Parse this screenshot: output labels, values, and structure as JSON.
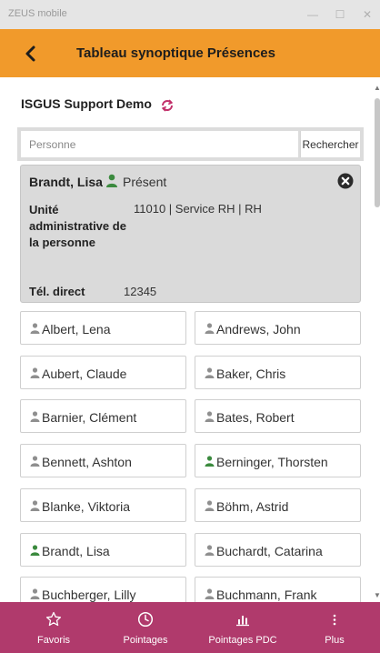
{
  "window": {
    "title": "ZEUS mobile",
    "controls": {
      "minimize": "—",
      "maximize": "☐",
      "close": "✕"
    }
  },
  "header": {
    "back_icon": "chevron-left-icon",
    "title": "Tableau synoptique Présences"
  },
  "org": {
    "name": "ISGUS Support Demo",
    "refresh_icon": "refresh-icon"
  },
  "search": {
    "placeholder": "Personne",
    "value": "",
    "button_label": "Rechercher"
  },
  "detail": {
    "name": "Brandt, Lisa",
    "status": "Présent",
    "status_color": "#3b8a3e",
    "unit_label": "Unité administrative de la personne",
    "unit_value": "11010 | Service RH |  RH",
    "tel_label": "Tél. direct",
    "tel_value": "12345"
  },
  "colors": {
    "accent_orange": "#f19a2b",
    "nav_magenta": "#b03a6c",
    "present_green": "#3b8a3e",
    "absent_gray": "#8f8f8f"
  },
  "persons": [
    {
      "name": "Albert, Lena",
      "present": false
    },
    {
      "name": "Andrews, John",
      "present": false
    },
    {
      "name": "Aubert, Claude",
      "present": false
    },
    {
      "name": "Baker, Chris",
      "present": false
    },
    {
      "name": "Barnier, Clément",
      "present": false
    },
    {
      "name": "Bates, Robert",
      "present": false
    },
    {
      "name": "Bennett, Ashton",
      "present": false
    },
    {
      "name": "Berninger, Thorsten",
      "present": true
    },
    {
      "name": "Blanke, Viktoria",
      "present": false
    },
    {
      "name": "Böhm, Astrid",
      "present": false
    },
    {
      "name": "Brandt, Lisa",
      "present": true
    },
    {
      "name": "Buchardt, Catarina",
      "present": false
    },
    {
      "name": "Buchberger, Lilly",
      "present": false
    },
    {
      "name": "Buchmann, Frank",
      "present": false
    }
  ],
  "nav": [
    {
      "label": "Favoris",
      "icon": "star-icon"
    },
    {
      "label": "Pointages",
      "icon": "clock-icon"
    },
    {
      "label": "Pointages PDC",
      "icon": "bar-chart-icon"
    },
    {
      "label": "Plus",
      "icon": "more-vertical-icon"
    }
  ]
}
